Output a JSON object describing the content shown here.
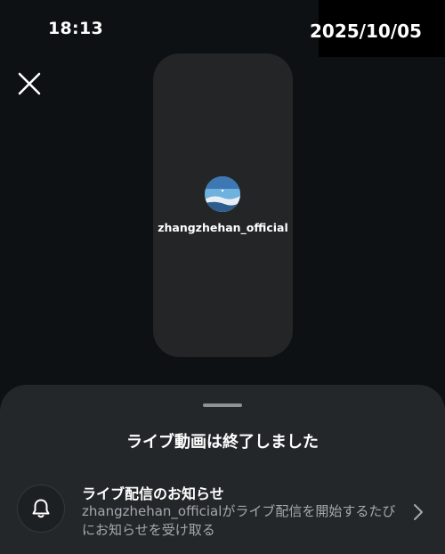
{
  "status_bar": {
    "time": "18:13",
    "date": "2025/10/05"
  },
  "icons": {
    "close": "close-icon",
    "bell": "bell-icon",
    "chevron": "chevron-right-icon"
  },
  "preview": {
    "username": "zhangzhehan_official"
  },
  "sheet": {
    "title": "ライブ動画は終了しました",
    "notification": {
      "title": "ライブ配信のお知らせ",
      "username": "zhangzhehan_official",
      "description_suffix": "がライブ配信を開始するたびにお知らせを受け取る"
    }
  },
  "colors": {
    "background": "#0d1114",
    "card": "#232527",
    "sheet": "#24272a",
    "secondary_text": "#a3a8ad"
  }
}
